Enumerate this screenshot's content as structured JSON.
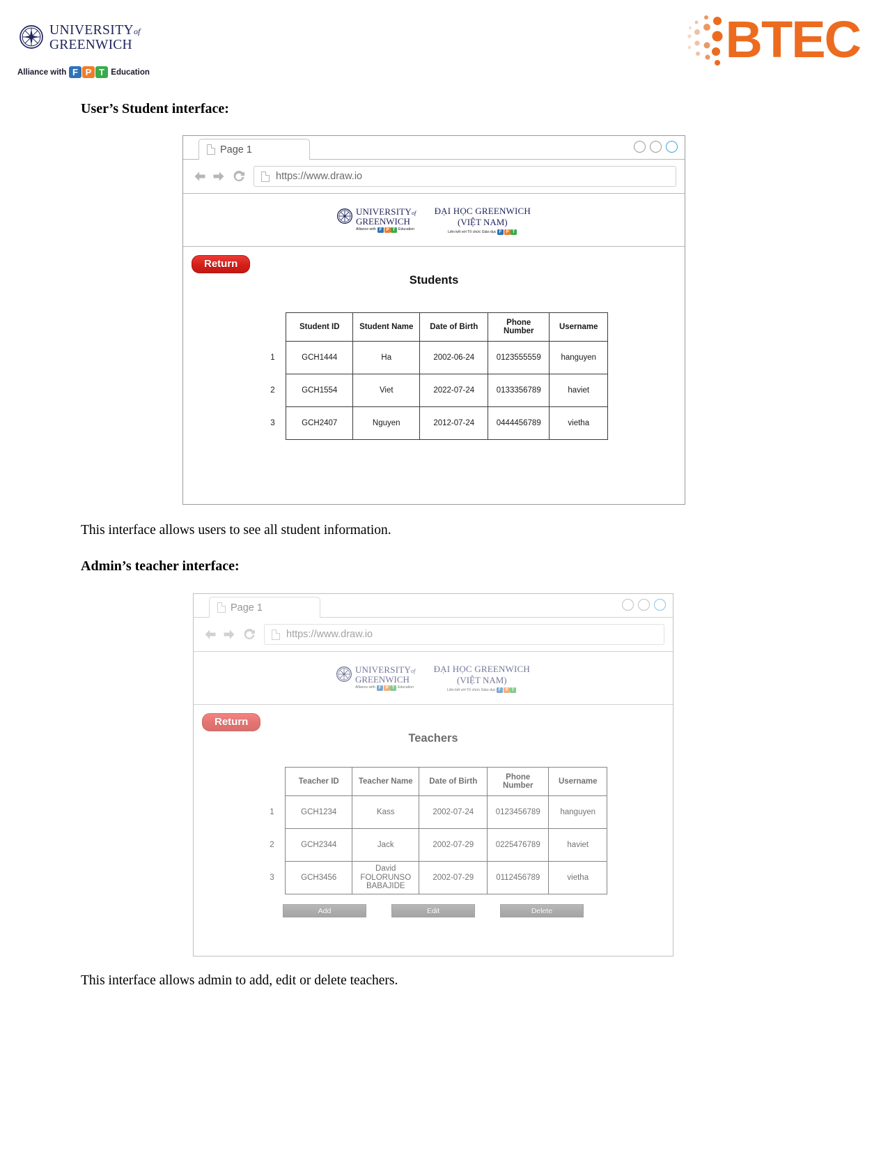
{
  "header": {
    "university_line1": "UNIVERSITY",
    "university_of": "of",
    "university_line2": "GREENWICH",
    "alliance_text_pre": "Alliance with",
    "alliance_text_post": "Education",
    "fpt_letters": [
      "F",
      "P",
      "T"
    ],
    "btec_text": "BTEC"
  },
  "sections": [
    {
      "heading": "User’s Student interface:",
      "caption": "This interface allows users to see all student information."
    },
    {
      "heading": "Admin’s teacher interface:",
      "caption": "This interface allows admin to add, edit or delete teachers."
    }
  ],
  "mockup_student": {
    "tab_label": "Page 1",
    "url": "https://www.draw.io",
    "uni_en_line1": "UNIVERSITY",
    "uni_en_of": "of",
    "uni_en_line2": "GREENWICH",
    "uni_en_sub_pre": "Alliance with",
    "uni_en_sub_post": "Education",
    "uni_vn_line1": "ĐẠI HỌC GREENWICH",
    "uni_vn_line2": "(VIỆT NAM)",
    "uni_vn_sub": "Liên kết với Tổ chức Giáo dục",
    "return_label": "Return",
    "title": "Students",
    "columns": [
      "",
      "Student ID",
      "Student Name",
      "Date of Birth",
      "Phone Number",
      "Username"
    ],
    "rows": [
      [
        "1",
        "GCH1444",
        "Ha",
        "2002-06-24",
        "0123555559",
        "hanguyen"
      ],
      [
        "2",
        "GCH1554",
        "Viet",
        "2022-07-24",
        "0133356789",
        "haviet"
      ],
      [
        "3",
        "GCH2407",
        "Nguyen",
        "2012-07-24",
        "0444456789",
        "vietha"
      ]
    ]
  },
  "mockup_teacher": {
    "tab_label": "Page 1",
    "url": "https://www.draw.io",
    "uni_en_line1": "UNIVERSITY",
    "uni_en_of": "of",
    "uni_en_line2": "GREENWICH",
    "uni_en_sub_pre": "Alliance with",
    "uni_en_sub_post": "Education",
    "uni_vn_line1": "ĐẠI HỌC GREENWICH",
    "uni_vn_line2": "(VIỆT NAM)",
    "uni_vn_sub": "Liên kết với Tổ chức Giáo dục",
    "return_label": "Return",
    "title": "Teachers",
    "columns": [
      "",
      "Teacher ID",
      "Teacher Name",
      "Date of Birth",
      "Phone Number",
      "Username"
    ],
    "rows": [
      [
        "1",
        "GCH1234",
        "Kass",
        "2002-07-24",
        "0123456789",
        "hanguyen"
      ],
      [
        "2",
        "GCH2344",
        "Jack",
        "2002-07-29",
        "0225476789",
        "haviet"
      ],
      [
        "3",
        "GCH3456",
        "David FOLORUNSO BABAJIDE",
        "2002-07-29",
        "0112456789",
        "vietha"
      ]
    ],
    "actions": [
      "Add",
      "Edit",
      "Delete"
    ]
  },
  "colors": {
    "brand_navy": "#20255c",
    "btec_orange": "#ec6b1f",
    "return_red": "#d41f1a",
    "action_gray": "#7b7b7b",
    "window_accent": "#41a5d6"
  }
}
